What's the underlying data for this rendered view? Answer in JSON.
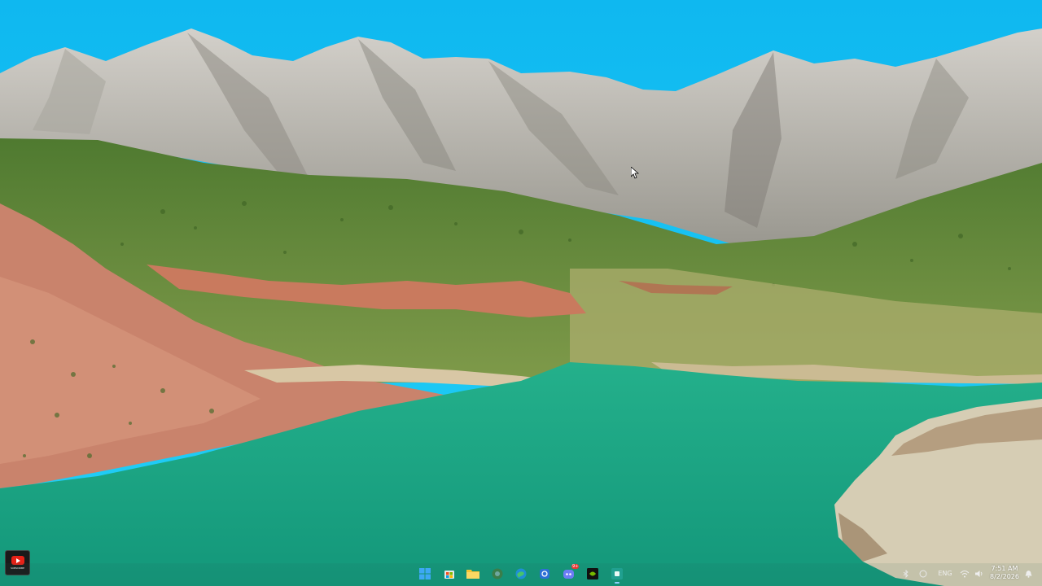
{
  "desktop": {
    "wallpaper": "mountain-lake-landscape",
    "colors": {
      "sky": "#0ec2f4",
      "water": "#1fa382",
      "rock": "#b9b6ae",
      "grass": "#5f8a3a",
      "red_soil": "#c77660"
    }
  },
  "overlay": {
    "badge_icon": "youtube-subscribe-icon",
    "badge_text": "SUBSCRIBE"
  },
  "taskbar": {
    "icons": [
      {
        "name": "start-icon",
        "glyph": "⊞"
      },
      {
        "name": "store-icon",
        "glyph": "▦"
      },
      {
        "name": "file-explorer-icon",
        "glyph": "▬"
      },
      {
        "name": "chrome-icon",
        "glyph": "◉"
      },
      {
        "name": "edge-icon",
        "glyph": "◐"
      },
      {
        "name": "settings-icon",
        "glyph": "⚙"
      },
      {
        "name": "discord-icon",
        "glyph": "◕"
      },
      {
        "name": "nvidia-icon",
        "glyph": "▣"
      },
      {
        "name": "app-icon",
        "glyph": "▢"
      }
    ],
    "discord_badge": "9+"
  },
  "tray": {
    "language": "ENG",
    "time": "7:51 AM",
    "date": "8/2/2026"
  }
}
